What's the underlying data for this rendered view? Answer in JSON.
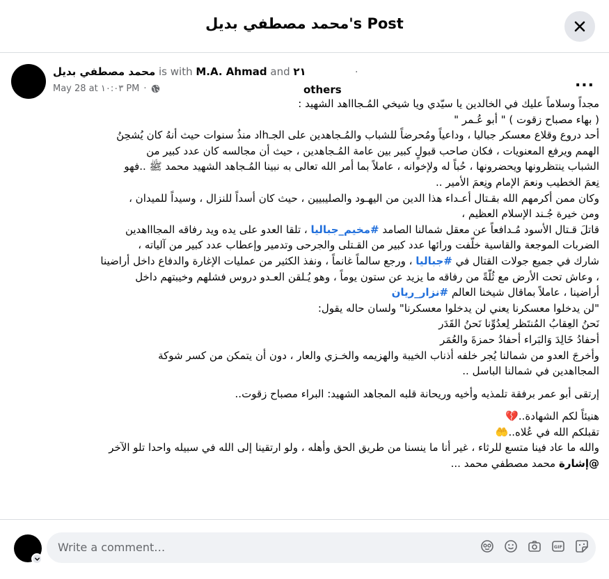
{
  "header": {
    "title": "محمد مصطفي بديل's Post"
  },
  "post": {
    "author_name": "محمد مصطفي بديل",
    "is_with": "is with",
    "tagged_name": "M.A. Ahmad",
    "and_label": "and",
    "others_count": "٢١",
    "others_label": "others",
    "dot": ".",
    "date": "May 28 at ١٠:٠٣ PM",
    "dot_sep": "·",
    "privacy_icon": "globe-icon",
    "more_label": "...",
    "lines": {
      "l1": "مجداً وسلاماً عليك في الخالدين يا سيّدي ويا شيخي المُـجاااهد الشهيد :",
      "l2": "( بهاء مصباح زقوت ) \" أبو عُـمر \"",
      "l3": "أحد دروع وقلاع معسكر جباليا ، وداعياً ومُحرضاً للشباب والمُـجاهدين على الجـhاد منذُ سنوات حيث أنهُ كان يُشحِنُ",
      "l4": "الهمم ويرفع المعنويات ، فكان صاحب قبولٍ كبير بين عامة المُـجاهدين ، حيث أن مجالسه كان عدد كبير من",
      "l5": "الشباب ينتظرونها ويحضرونها ، حُباً له ولإخوانه ، عاملاً بما أمر الله تعالى به نبينا المُـجاهد الشهيد محمد ﷺ ..فهو",
      "l6": "نِعمَ الخطيب ونعمَ الإمام ونِعمَ الأمير ..",
      "l7": "وكان ممن أكرمهم الله بقـتال أعـداء هذا الدين من اليهـود والصليبيين ، حيث كان أسداً للنزال ، وسيداً للميدان ،",
      "l8": "ومن خيرة جُـند الإسلام العظيم ،",
      "l9_pre": "قاتلَ قـتال الأسود مُـدافعاً عن معقل شمالنا الصامد ",
      "l9_tag": "#مخيم_جباليا",
      "l9_post": " ، تلقا العدو على يده ويد رفاقه المجاااهدين",
      "l10": "الضربات الموجعة والقاسية خلّفت ورائها عدد كبير من القـتلى والجرحى وتدمير وإعطاب عدد كبير من آلياته ،",
      "l11_pre": "شارك في جميع جولات القتال في ",
      "l11_tag": "#جباليا",
      "l11_post": " ، ورجع سالماً غانماً ، ونفذ الكثير من عمليات الإغارة والدفاع داخل أراضينا",
      "l12": "، وعاش تحت الأرض مع ثُلّةً من رفاقه ما يزيد عن ستون يوماً ، وهو يُـلقن العـدو دروس فشلهم وخيبتهم داخل",
      "l13_pre": "أراضينا ، عاملاً بماقال شيخنا العالم ",
      "l13_tag": "#نزار_ريان",
      "l14": "\"لن يدخلوا معسكرنا يعني لن يدخلوا معسكرنا\" ولسان حاله يقول:",
      "l15": "نَحنُ العِقابُ المُنتَظر لِعدُوِّنا نَحنُ القَدَر",
      "l16": "أحفادُ خَالِدَ وَالبَراء أحفادُ حمزةَ والعُمَر",
      "l17": "وأخرجَ العدو من شمالنا يُجر خلفه أذناب الخيبة والهزيمه والخـزي والعار ، دون أن يتمكن من كسر شوكة",
      "l18": "المجااهدين في شمالنا الباسل ..",
      "l19": "إرتقى أبو عمر برفقة تلمذيه وأخيه وريحانة قلبه المجاهد الشهيد: البراء مصباح زقوت..",
      "l20": "هنيئاً لكم الشهادة..💔",
      "l21": "تقبلكم الله في عُلاه..🤲",
      "l22": "والله ما عاد فينا متسع للرثاء ، غير أنا ما ينسنا من طريق الحق وأهله ، ولو ارتقينا إلى الله في سبيله واحدا تلو الآخر",
      "l23_mention": "@إشارة",
      "l23_post": " محمد مصطفي محمد ..."
    }
  },
  "comment": {
    "placeholder": "Write a comment…",
    "icons": [
      "avatar-sticker-icon",
      "emoji-icon",
      "camera-icon",
      "gif-icon",
      "sticker-icon"
    ]
  }
}
